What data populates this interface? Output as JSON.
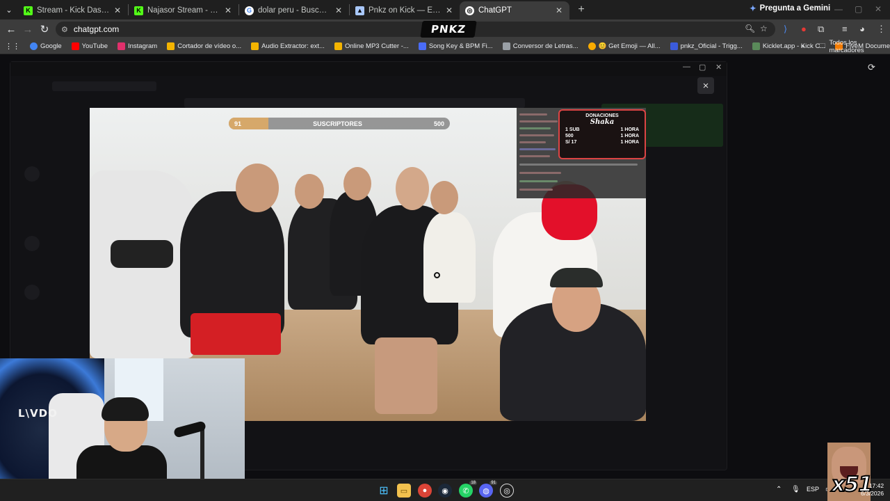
{
  "tabs": [
    {
      "title": "Stream - Kick Dashboard",
      "favicon": "kick-icon",
      "color": "#53fc18",
      "active": false
    },
    {
      "title": "Najasor Stream - Watch Live on Kick",
      "favicon": "kick-icon",
      "color": "#53fc18",
      "active": false
    },
    {
      "title": "dolar peru - Buscar con Google",
      "favicon": "google-icon",
      "color": "#ffffff",
      "active": false
    },
    {
      "title": "Pnkz on Kick — Engagement Analytics",
      "favicon": "analytics-icon",
      "color": "#a8c7fa",
      "active": false
    },
    {
      "title": "ChatGPT",
      "favicon": "chatgpt-icon",
      "color": "#ffffff",
      "active": true
    }
  ],
  "gemini": {
    "label": "Pregunta a Gemini",
    "icon": "gemini-icon"
  },
  "address": {
    "url": "chatgpt.com"
  },
  "overlay_logo": "PNKZ",
  "bookmarks": [
    {
      "label": "Google",
      "color": "#4285f4"
    },
    {
      "label": "YouTube",
      "color": "#ff0000"
    },
    {
      "label": "Instagram",
      "color": "#e1306c"
    },
    {
      "label": "Cortador de vídeo o...",
      "color": "#f4b400"
    },
    {
      "label": "Audio Extractor: ext...",
      "color": "#f4b400"
    },
    {
      "label": "Online MP3 Cutter -...",
      "color": "#f4b400"
    },
    {
      "label": "Song Key & BPM Fi...",
      "color": "#4a6cf7"
    },
    {
      "label": "Conversor de Letras...",
      "color": "#9aa0a6"
    },
    {
      "label": "😊 Get Emoji — All...",
      "color": "#f9ab00"
    },
    {
      "label": "pnkz_Oficial - Trigg...",
      "color": "#3b5bdb"
    },
    {
      "label": "Kicklet.app - Kick C...",
      "color": "#5a8a5a"
    },
    {
      "label": "FiveM Documentati...",
      "color": "#f57c00"
    }
  ],
  "bookmarks_all": "Todos los marcadores",
  "video": {
    "sub_goal": {
      "current": "91",
      "label": "SUSCRIPTORES",
      "target": "500",
      "progress": 0.18
    },
    "donations": {
      "title": "DONACIONES",
      "name": "Shaka",
      "rows": [
        {
          "left": "1 SUB",
          "right": "1 HORA"
        },
        {
          "left": "500",
          "right": "1 HORA"
        },
        {
          "left": "S/ 17",
          "right": "1 HORA"
        }
      ]
    }
  },
  "lightbox_close": "×",
  "taskbar": {
    "badges": {
      "whatsapp": "18",
      "discord": "91"
    },
    "lang": "ESP",
    "time": "17:42",
    "date": "6/3/2026"
  },
  "emote_overlay": "x51"
}
